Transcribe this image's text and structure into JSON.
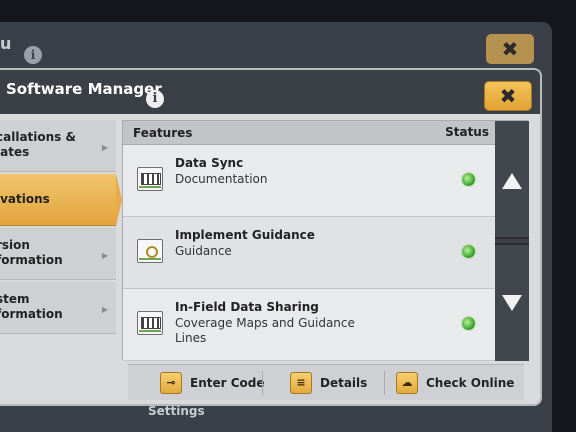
{
  "background_window": {
    "title_fragment": "u",
    "close_glyph": "✖",
    "bottom_text": "Settings"
  },
  "dialog": {
    "title": "Software Manager",
    "info_glyph": "i",
    "close_glyph": "✖"
  },
  "sidebar": {
    "items": [
      {
        "line1": "callations &",
        "line2": "lates",
        "active": false
      },
      {
        "line1": "ivations",
        "line2": "",
        "active": true
      },
      {
        "line1": "rsion",
        "line2": "formation",
        "active": false
      },
      {
        "line1": "stem",
        "line2": "formation",
        "active": false
      }
    ],
    "chevron_glyph": "▶"
  },
  "list": {
    "header": {
      "features": "Features",
      "status": "Status"
    },
    "rows": [
      {
        "title": "Data Sync",
        "subtitle": "Documentation",
        "icon": "documentation-icon",
        "status": "active"
      },
      {
        "title": "Implement Guidance",
        "subtitle": "Guidance",
        "icon": "guidance-icon",
        "status": "active"
      },
      {
        "title": "In-Field Data Sharing",
        "subtitle": "Coverage Maps and Guidance Lines",
        "icon": "documentation-icon",
        "status": "active"
      }
    ]
  },
  "footer": {
    "enter_code": "Enter Code",
    "details": "Details",
    "check_online": "Check Online",
    "enter_code_icon": "key-icon",
    "details_icon": "document-icon",
    "check_online_icon": "cloud-download-icon"
  },
  "colors": {
    "accent": "#e6ab45",
    "status_on": "#3fa72e",
    "header_bg": "#3b3f46"
  }
}
